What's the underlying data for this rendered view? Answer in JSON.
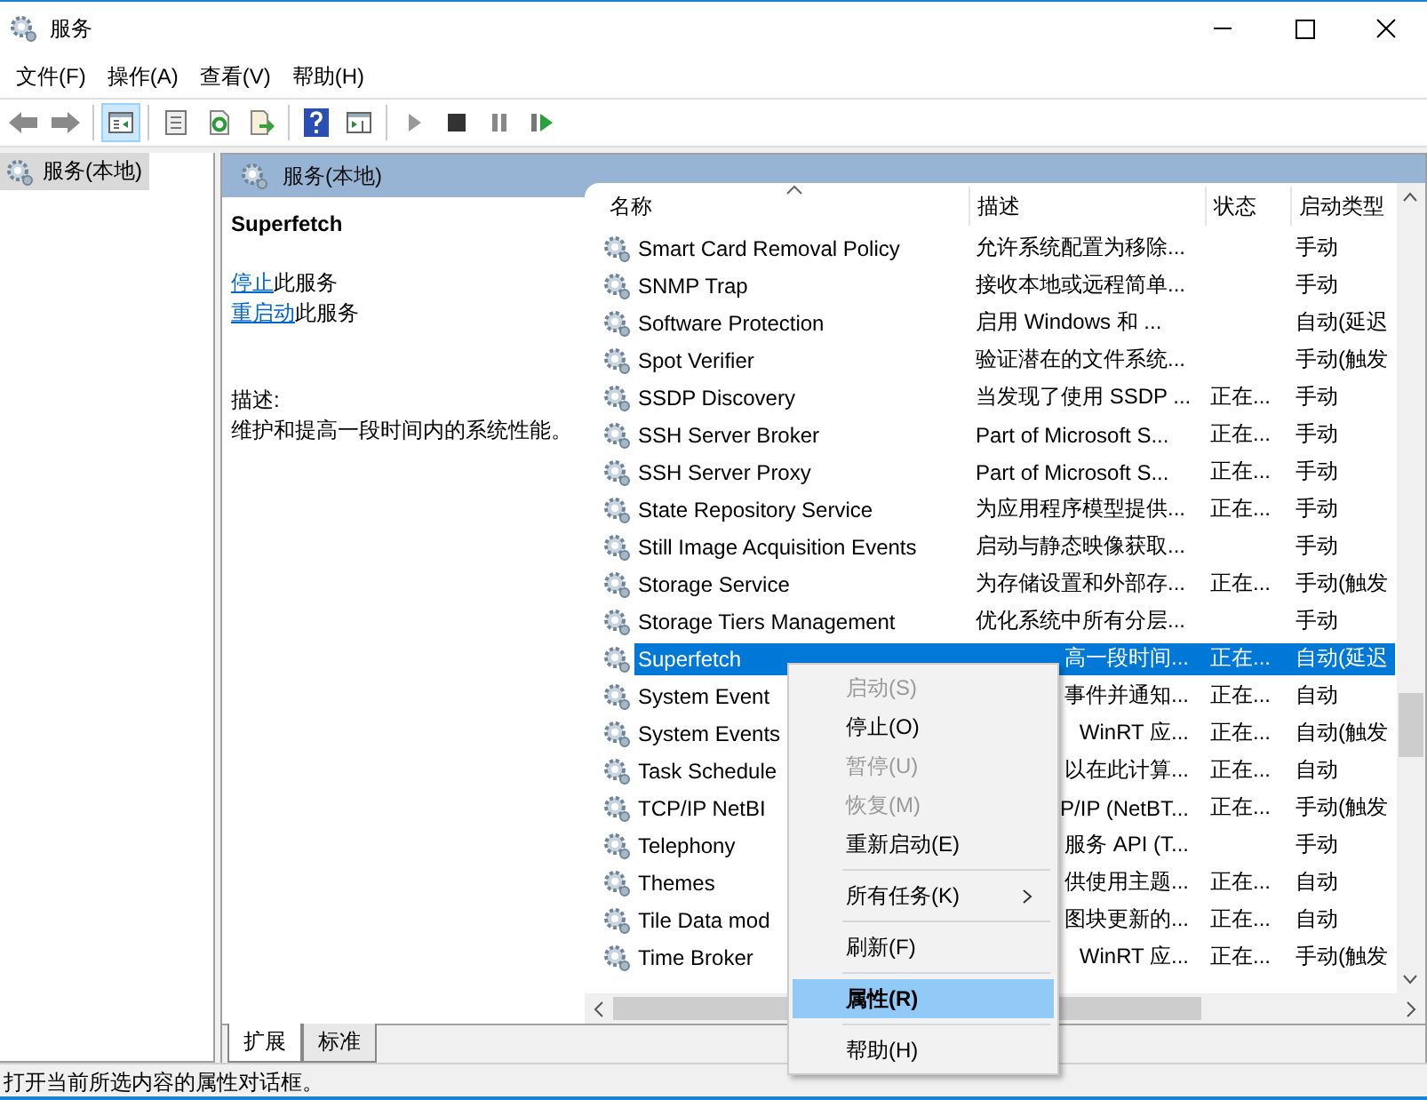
{
  "window": {
    "title": "服务"
  },
  "menu_bar": [
    "文件(F)",
    "操作(A)",
    "查看(V)",
    "帮助(H)"
  ],
  "toolbar": [
    {
      "kind": "back",
      "selected": false
    },
    {
      "kind": "forward",
      "selected": false
    },
    {
      "kind": "sep"
    },
    {
      "kind": "tree",
      "selected": true
    },
    {
      "kind": "sep"
    },
    {
      "kind": "list",
      "selected": false
    },
    {
      "kind": "refresh",
      "selected": false
    },
    {
      "kind": "export",
      "selected": false
    },
    {
      "kind": "sep"
    },
    {
      "kind": "help",
      "selected": false
    },
    {
      "kind": "console",
      "selected": false
    },
    {
      "kind": "sep"
    },
    {
      "kind": "play",
      "selected": false
    },
    {
      "kind": "stop",
      "selected": false
    },
    {
      "kind": "pause",
      "selected": false
    },
    {
      "kind": "resume",
      "selected": false
    }
  ],
  "tree": [
    {
      "label": "服务(本地)",
      "selected": true
    }
  ],
  "pane": {
    "title": "服务(本地)"
  },
  "details": {
    "service_name": "Superfetch",
    "actions": [
      {
        "link": "停止",
        "text": "此服务"
      },
      {
        "link": "重启动",
        "text": "此服务"
      }
    ],
    "description_label": "描述:",
    "description": "维护和提高一段时间内的系统性能。"
  },
  "table": {
    "columns": [
      "名称",
      "描述",
      "状态",
      "启动类型"
    ],
    "rows": [
      {
        "name": "Smart Card Removal Policy",
        "description": "允许系统配置为移除...",
        "status": "",
        "startup": "手动",
        "selected": false
      },
      {
        "name": "SNMP Trap",
        "description": "接收本地或远程简单...",
        "status": "",
        "startup": "手动",
        "selected": false
      },
      {
        "name": "Software Protection",
        "description": "启用 Windows 和 ...",
        "status": "",
        "startup": "自动(延迟",
        "selected": false
      },
      {
        "name": "Spot Verifier",
        "description": "验证潜在的文件系统...",
        "status": "",
        "startup": "手动(触发",
        "selected": false
      },
      {
        "name": "SSDP Discovery",
        "description": "当发现了使用 SSDP ...",
        "status": "正在...",
        "startup": "手动",
        "selected": false
      },
      {
        "name": "SSH Server Broker",
        "description": "Part of Microsoft S...",
        "status": "正在...",
        "startup": "手动",
        "selected": false
      },
      {
        "name": "SSH Server Proxy",
        "description": "Part of Microsoft S...",
        "status": "正在...",
        "startup": "手动",
        "selected": false
      },
      {
        "name": "State Repository Service",
        "description": "为应用程序模型提供...",
        "status": "正在...",
        "startup": "手动",
        "selected": false
      },
      {
        "name": "Still Image Acquisition Events",
        "description": "启动与静态映像获取...",
        "status": "",
        "startup": "手动",
        "selected": false
      },
      {
        "name": "Storage Service",
        "description": "为存储设置和外部存...",
        "status": "正在...",
        "startup": "手动(触发",
        "selected": false
      },
      {
        "name": "Storage Tiers Management",
        "description": "优化系统中所有分层...",
        "status": "",
        "startup": "手动",
        "selected": false
      },
      {
        "name": "Superfetch",
        "description": "高一段时间...",
        "status": "正在...",
        "startup": "自动(延迟",
        "selected": true
      },
      {
        "name": "System Event",
        "description": "事件并通知...",
        "status": "正在...",
        "startup": "自动",
        "selected": false
      },
      {
        "name": "System Events",
        "description": "WinRT 应...",
        "status": "正在...",
        "startup": "自动(触发",
        "selected": false
      },
      {
        "name": "Task Schedule",
        "description": "以在此计算...",
        "status": "正在...",
        "startup": "自动",
        "selected": false
      },
      {
        "name": "TCP/IP NetBI",
        "description": "P/IP (NetBT...",
        "status": "正在...",
        "startup": "手动(触发",
        "selected": false
      },
      {
        "name": "Telephony",
        "description": "服务 API (T...",
        "status": "",
        "startup": "手动",
        "selected": false
      },
      {
        "name": "Themes",
        "description": "供使用主题...",
        "status": "正在...",
        "startup": "自动",
        "selected": false
      },
      {
        "name": "Tile Data mod",
        "description": "图块更新的...",
        "status": "正在...",
        "startup": "自动",
        "selected": false
      },
      {
        "name": "Time Broker",
        "description": "WinRT 应...",
        "status": "正在...",
        "startup": "手动(触发",
        "selected": false
      }
    ]
  },
  "view_tabs": [
    {
      "label": "扩展",
      "selected": true
    },
    {
      "label": "标准",
      "selected": false
    }
  ],
  "context_menu": [
    {
      "kind": "item",
      "label": "启动(S)",
      "disabled": true,
      "selected": false
    },
    {
      "kind": "item",
      "label": "停止(O)",
      "disabled": false,
      "selected": false
    },
    {
      "kind": "item",
      "label": "暂停(U)",
      "disabled": true,
      "selected": false
    },
    {
      "kind": "item",
      "label": "恢复(M)",
      "disabled": true,
      "selected": false
    },
    {
      "kind": "item",
      "label": "重新启动(E)",
      "disabled": false,
      "selected": false
    },
    {
      "kind": "separator"
    },
    {
      "kind": "submenu",
      "label": "所有任务(K)",
      "disabled": false,
      "selected": false
    },
    {
      "kind": "separator"
    },
    {
      "kind": "item",
      "label": "刷新(F)",
      "disabled": false,
      "selected": false
    },
    {
      "kind": "separator"
    },
    {
      "kind": "item",
      "label": "属性(R)",
      "disabled": false,
      "selected": true
    },
    {
      "kind": "separator"
    },
    {
      "kind": "item",
      "label": "帮助(H)",
      "disabled": false,
      "selected": false
    }
  ],
  "status_bar": "打开当前所选内容的属性对话框。"
}
